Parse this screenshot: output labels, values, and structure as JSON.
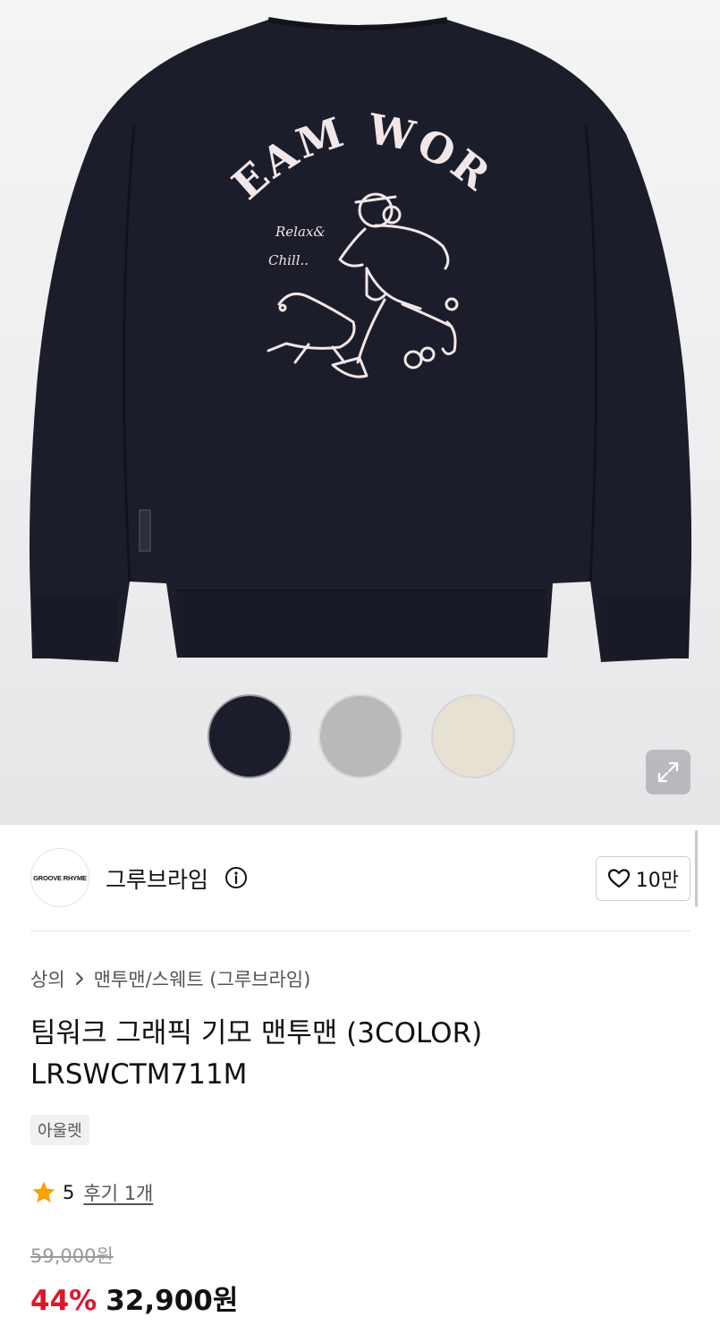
{
  "product_image": {
    "graphic_title": "TEAM WORK",
    "graphic_script_line1": "Relax&",
    "graphic_script_line2": "Chill..",
    "icon": "sweatshirt-photo",
    "colors": {
      "background": "#efeff1",
      "garment": "#1b1e2a",
      "print": "#f3e6e6"
    }
  },
  "color_swatches": [
    {
      "name": "navy",
      "color": "#1b1e2a",
      "selected": true
    },
    {
      "name": "gray",
      "color": "#b9b9bc",
      "selected": false
    },
    {
      "name": "cream",
      "color": "#e7e1d2",
      "selected": false
    }
  ],
  "expand": {
    "icon": "expand-arrows-icon"
  },
  "brand": {
    "logo_text": "GROOVE RHYME",
    "name": "그루브라임",
    "info_icon": "info-icon",
    "like_icon": "heart-outline-icon",
    "like_count": "10만"
  },
  "breadcrumb": {
    "category": "상의",
    "separator_icon": "chevron-right-icon",
    "subcategory": "맨투맨/스웨트 (그루브라임)"
  },
  "product": {
    "title": "팀워크 그래픽 기모 맨투맨 (3COLOR) LRSWCTM711M",
    "tag": "아울렛",
    "rating": "5",
    "rating_icon": "star-icon",
    "review_text": "후기 1개"
  },
  "price": {
    "original": "59,000원",
    "discount": "44%",
    "final": "32,900원",
    "discount_color": "#e0162b"
  }
}
